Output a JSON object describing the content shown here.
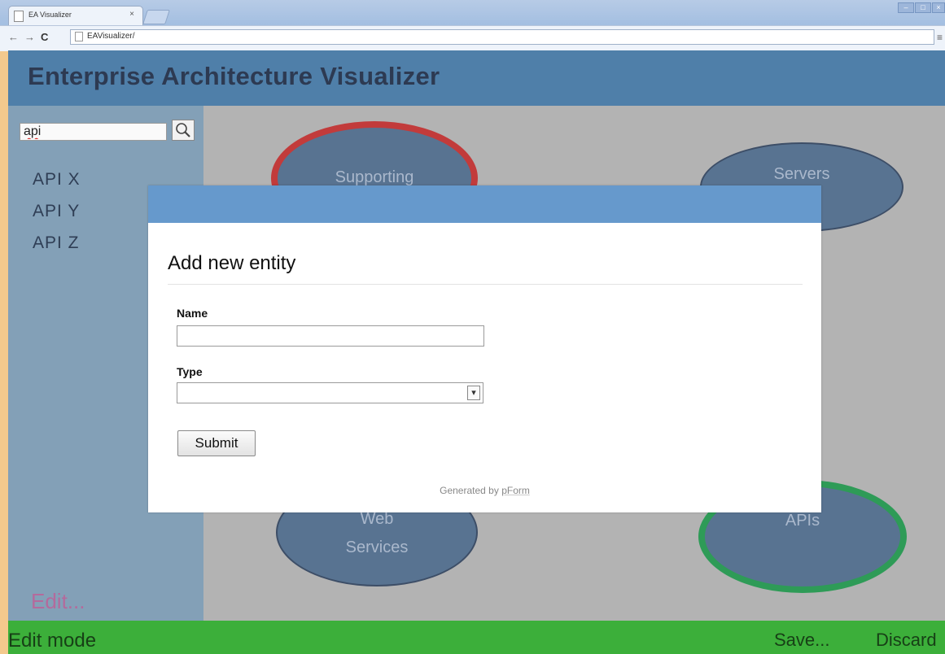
{
  "browser": {
    "tab_title": "EA Visualizer",
    "tab_close": "×",
    "address": "EAVisualizer/",
    "back": "←",
    "forward": "→",
    "reload": "C",
    "menu": "≡"
  },
  "app": {
    "title": "Enterprise Architecture Visualizer"
  },
  "sidebar": {
    "search_value": "api",
    "items": [
      {
        "label": "API X"
      },
      {
        "label": "API Y"
      },
      {
        "label": "API Z"
      }
    ],
    "edit_label": "Edit..."
  },
  "canvas": {
    "nodes": [
      {
        "label": "Supporting"
      },
      {
        "label": "Servers"
      },
      {
        "label_line1": "Web",
        "label_line2": "Services"
      },
      {
        "label": "APIs"
      }
    ]
  },
  "modal": {
    "title": "Add new entity",
    "name_label": "Name",
    "name_value": "",
    "type_label": "Type",
    "type_value": "",
    "submit_label": "Submit",
    "generated_prefix": "Generated by",
    "generated_link": "pForm"
  },
  "footer": {
    "mode_label": "Edit mode",
    "save_label": "Save...",
    "discard_label": "Discard"
  },
  "colors": {
    "header": "#4f7fa9",
    "sidebar": "#83a0b7",
    "canvas": "#b3b3b3",
    "node_fill": "#587391",
    "node_highlight_red": "#c23b3b",
    "node_highlight_green": "#2e9b57",
    "footer": "#3caf3a",
    "modal_header": "#6699cc",
    "edit_link": "#b46a9c"
  }
}
